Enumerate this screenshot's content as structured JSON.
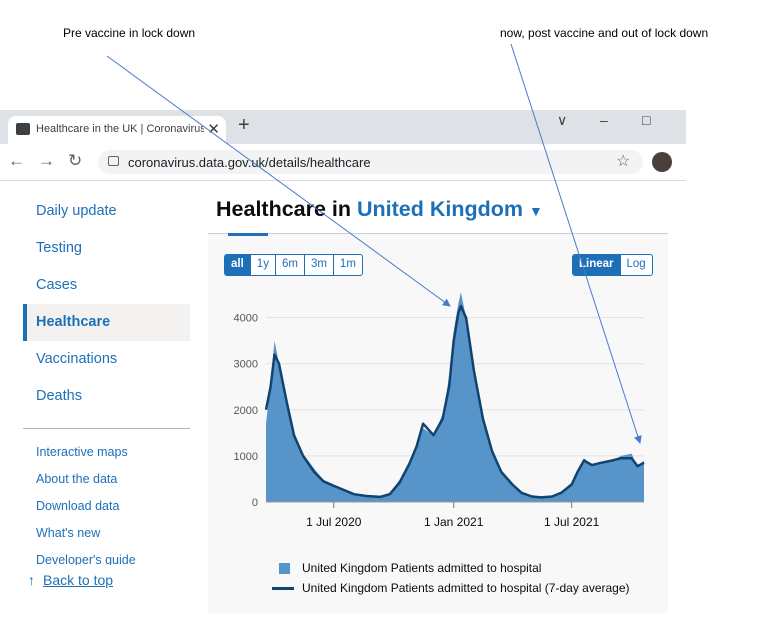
{
  "annotations": {
    "left": "Pre vaccine in lock down",
    "right": "now, post vaccine and out of lock down"
  },
  "browser": {
    "tab_title": "Healthcare in the UK | Coronavirus",
    "tab_close": "✕",
    "new_tab": "+",
    "url": "coronavirus.data.gov.uk/details/healthcare",
    "window_controls": [
      "∨",
      "–",
      "□"
    ]
  },
  "sidebar": {
    "items": [
      {
        "label": "Daily update"
      },
      {
        "label": "Testing"
      },
      {
        "label": "Cases"
      },
      {
        "label": "Healthcare"
      },
      {
        "label": "Vaccinations"
      },
      {
        "label": "Deaths"
      }
    ],
    "links": [
      {
        "label": "Interactive maps"
      },
      {
        "label": "About the data"
      },
      {
        "label": "Download data"
      },
      {
        "label": "What's new"
      },
      {
        "label": "Developer's guide"
      }
    ],
    "back_to_top": "Back to top"
  },
  "main": {
    "title_prefix": "Healthcare in",
    "location": "United Kingdom",
    "time_buttons": [
      "all",
      "1y",
      "6m",
      "3m",
      "1m"
    ],
    "active_time": "all",
    "scale_buttons": [
      "Linear",
      "Log"
    ],
    "active_scale": "Linear",
    "legend": [
      {
        "label": "United Kingdom Patients admitted to hospital"
      },
      {
        "label": "United Kingdom Patients admitted to hospital (7-day average)"
      }
    ]
  },
  "colors": {
    "accent": "#1d70b8",
    "bar_fill": "#5694ca",
    "avg_line": "#12436d"
  },
  "chart_data": {
    "type": "area",
    "x_tick_labels": [
      "1 Jul 2020",
      "1 Jan 2021",
      "1 Jul 2021"
    ],
    "y_tick_labels": [
      "0",
      "1000",
      "2000",
      "3000",
      "4000"
    ],
    "ylim": [
      0,
      4600
    ],
    "xlim": [
      "2020-03-19",
      "2021-10-20"
    ],
    "grid": true,
    "legend_position": "bottom",
    "x": [
      "2020-03-19",
      "2020-03-26",
      "2020-04-01",
      "2020-04-08",
      "2020-04-20",
      "2020-05-01",
      "2020-05-15",
      "2020-06-01",
      "2020-06-15",
      "2020-07-01",
      "2020-07-15",
      "2020-08-01",
      "2020-08-20",
      "2020-09-10",
      "2020-09-25",
      "2020-10-10",
      "2020-10-25",
      "2020-11-05",
      "2020-11-15",
      "2020-12-01",
      "2020-12-15",
      "2020-12-25",
      "2021-01-01",
      "2021-01-08",
      "2021-01-12",
      "2021-01-20",
      "2021-02-01",
      "2021-02-15",
      "2021-03-01",
      "2021-03-15",
      "2021-04-01",
      "2021-04-15",
      "2021-05-01",
      "2021-05-15",
      "2021-06-01",
      "2021-06-15",
      "2021-07-01",
      "2021-07-10",
      "2021-07-20",
      "2021-08-01",
      "2021-08-15",
      "2021-09-01",
      "2021-09-15",
      "2021-10-01",
      "2021-10-10",
      "2021-10-20"
    ],
    "series": [
      {
        "name": "United Kingdom Patients admitted to hospital",
        "values": [
          1700,
          2600,
          3500,
          3000,
          2100,
          1500,
          1050,
          720,
          480,
          380,
          300,
          190,
          140,
          120,
          200,
          480,
          880,
          1250,
          1600,
          1450,
          1900,
          2700,
          3700,
          4300,
          4550,
          4000,
          2900,
          1850,
          1150,
          700,
          400,
          220,
          130,
          110,
          140,
          220,
          420,
          700,
          950,
          800,
          850,
          900,
          1000,
          1050,
          750,
          900
        ]
      },
      {
        "name": "United Kingdom Patients admitted to hospital (7-day average)",
        "values": [
          2000,
          2500,
          3200,
          3000,
          2150,
          1450,
          1000,
          650,
          450,
          350,
          270,
          170,
          130,
          110,
          170,
          420,
          830,
          1200,
          1700,
          1450,
          1800,
          2500,
          3500,
          4100,
          4250,
          4000,
          2850,
          1800,
          1100,
          650,
          380,
          200,
          120,
          100,
          120,
          200,
          380,
          650,
          900,
          800,
          850,
          900,
          950,
          950,
          780,
          850
        ]
      }
    ]
  }
}
